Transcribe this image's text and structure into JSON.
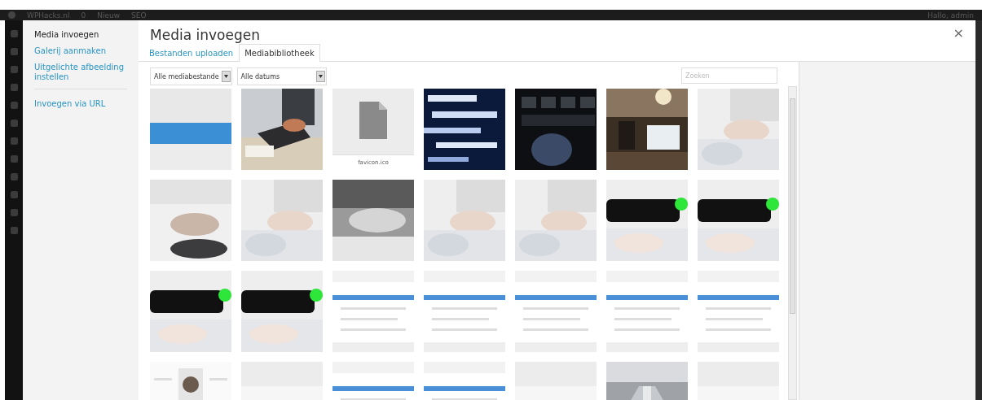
{
  "admin_bar": {
    "site": "WPHacks.nl",
    "comments": "0",
    "new": "Nieuw",
    "seo": "SEO",
    "greeting": "Hallo, admin"
  },
  "sidebar": {
    "items": [
      {
        "label": "Media invoegen",
        "selected": true
      },
      {
        "label": "Galerij aanmaken",
        "selected": false
      },
      {
        "label": "Uitgelichte afbeelding instellen",
        "selected": false
      },
      {
        "label": "Invoegen via URL",
        "selected": false
      }
    ]
  },
  "modal": {
    "title": "Media invoegen",
    "close": "×"
  },
  "tabs": [
    {
      "label": "Bestanden uploaden",
      "selected": false
    },
    {
      "label": "Mediabibliotheek",
      "selected": true
    }
  ],
  "filters": [
    {
      "value": "Alle mediabestande"
    },
    {
      "value": "Alle datums"
    }
  ],
  "search": {
    "placeholder": "Zoeken"
  },
  "thumbnails": [
    {
      "kind": "picture"
    },
    {
      "kind": "picture"
    },
    {
      "kind": "file",
      "filename": "favicon.ico"
    },
    {
      "kind": "picture"
    },
    {
      "kind": "picture"
    },
    {
      "kind": "picture"
    },
    {
      "kind": "picture"
    },
    {
      "kind": "picture"
    },
    {
      "kind": "picture"
    },
    {
      "kind": "picture"
    },
    {
      "kind": "picture"
    },
    {
      "kind": "picture"
    },
    {
      "kind": "picture"
    },
    {
      "kind": "picture"
    },
    {
      "kind": "picture"
    },
    {
      "kind": "picture"
    },
    {
      "kind": "picture"
    },
    {
      "kind": "picture"
    },
    {
      "kind": "picture"
    },
    {
      "kind": "picture"
    },
    {
      "kind": "picture"
    },
    {
      "kind": "picture"
    },
    {
      "kind": "picture"
    },
    {
      "kind": "picture"
    },
    {
      "kind": "picture"
    },
    {
      "kind": "picture"
    },
    {
      "kind": "picture"
    },
    {
      "kind": "picture"
    }
  ]
}
